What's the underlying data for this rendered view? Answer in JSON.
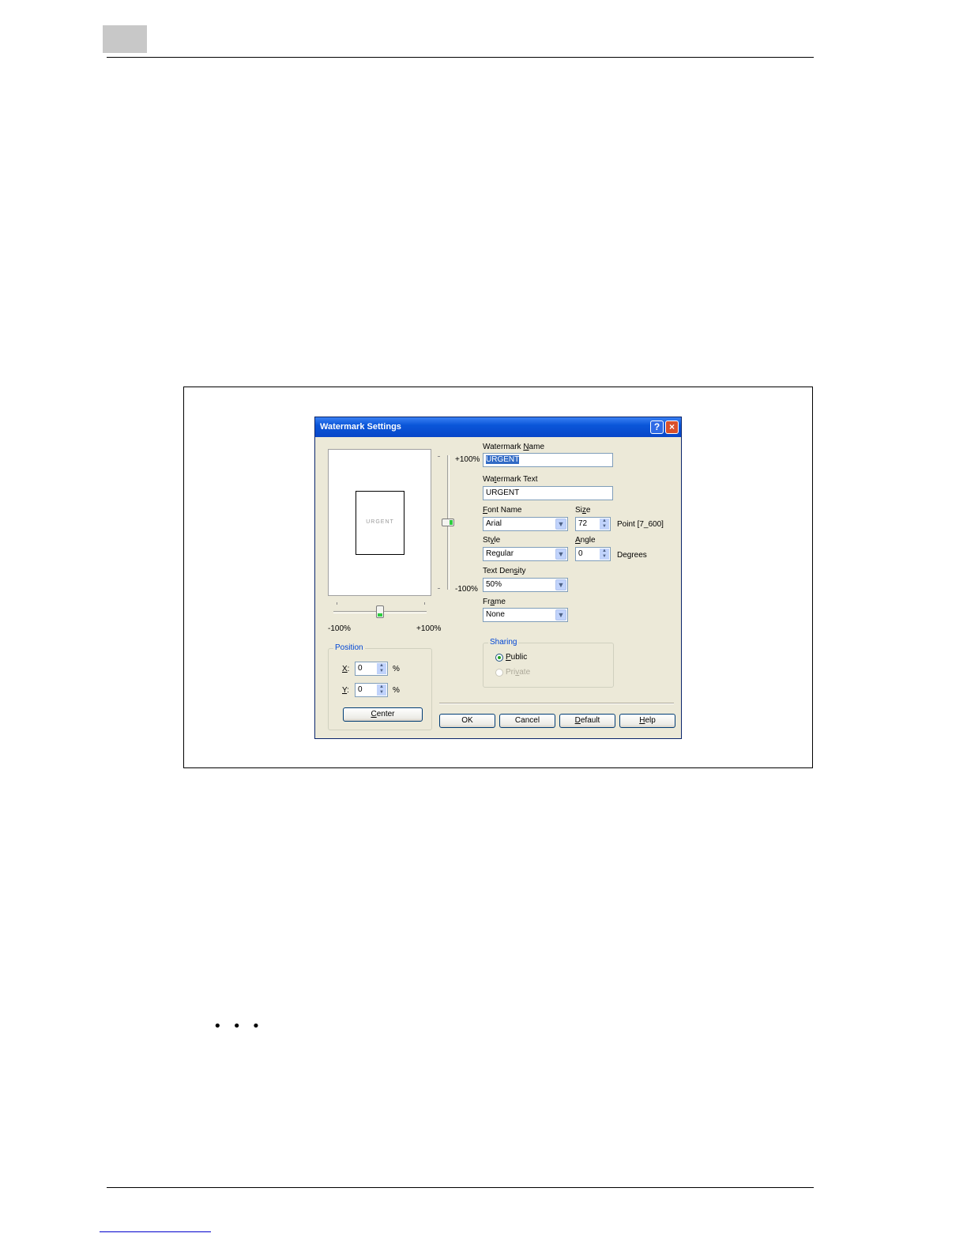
{
  "dialog": {
    "title": "Watermark Settings",
    "help_button": "?",
    "close_button": "×",
    "preview": {
      "sample_text": "URGENT"
    },
    "vertical_slider": {
      "top_label": "+100%",
      "bottom_label": "-100%",
      "value_percent": 0
    },
    "horizontal_slider": {
      "left_label": "-100%",
      "right_label": "+100%",
      "value_percent": 0
    },
    "watermark_name": {
      "label_pre": "Watermark ",
      "label_key": "N",
      "label_post": "ame",
      "value": "URGENT"
    },
    "watermark_text": {
      "label_pre": "Wa",
      "label_key": "t",
      "label_post": "ermark Text",
      "value": "URGENT"
    },
    "font_name": {
      "label_pre": "",
      "label_key": "F",
      "label_post": "ont Name",
      "value": "Arial"
    },
    "size": {
      "label_pre": "Si",
      "label_key": "z",
      "label_post": "e",
      "value": "72",
      "unit": "Point [7_600]"
    },
    "style": {
      "label_pre": "St",
      "label_key": "y",
      "label_post": "le",
      "value": "Regular"
    },
    "angle": {
      "label_pre": "",
      "label_key": "A",
      "label_post": "ngle",
      "value": "0",
      "unit": "Degrees"
    },
    "text_density": {
      "label_pre": "Text Den",
      "label_key": "s",
      "label_post": "ity",
      "value": "50%"
    },
    "frame": {
      "label_pre": "Fr",
      "label_key": "a",
      "label_post": "me",
      "value": "None"
    },
    "position": {
      "group_label": "Position",
      "x": {
        "label_key": "X",
        "label_post": ":",
        "value": "0",
        "unit": "%"
      },
      "y": {
        "label_key": "Y",
        "label_post": ":",
        "value": "0",
        "unit": "%"
      },
      "center_pre": "",
      "center_key": "C",
      "center_post": "enter"
    },
    "sharing": {
      "group_label": "Sharing",
      "public": {
        "label_pre": "",
        "label_key": "P",
        "label_post": "ublic",
        "checked": true
      },
      "private": {
        "label_pre": "Pri",
        "label_key": "v",
        "label_post": "ate",
        "disabled": true
      }
    },
    "buttons": {
      "ok": "OK",
      "cancel": "Cancel",
      "default_pre": "",
      "default_key": "D",
      "default_post": "efault",
      "help_pre": "",
      "help_key": "H",
      "help_post": "elp"
    }
  },
  "page": {
    "ellipsis": "• • •"
  }
}
